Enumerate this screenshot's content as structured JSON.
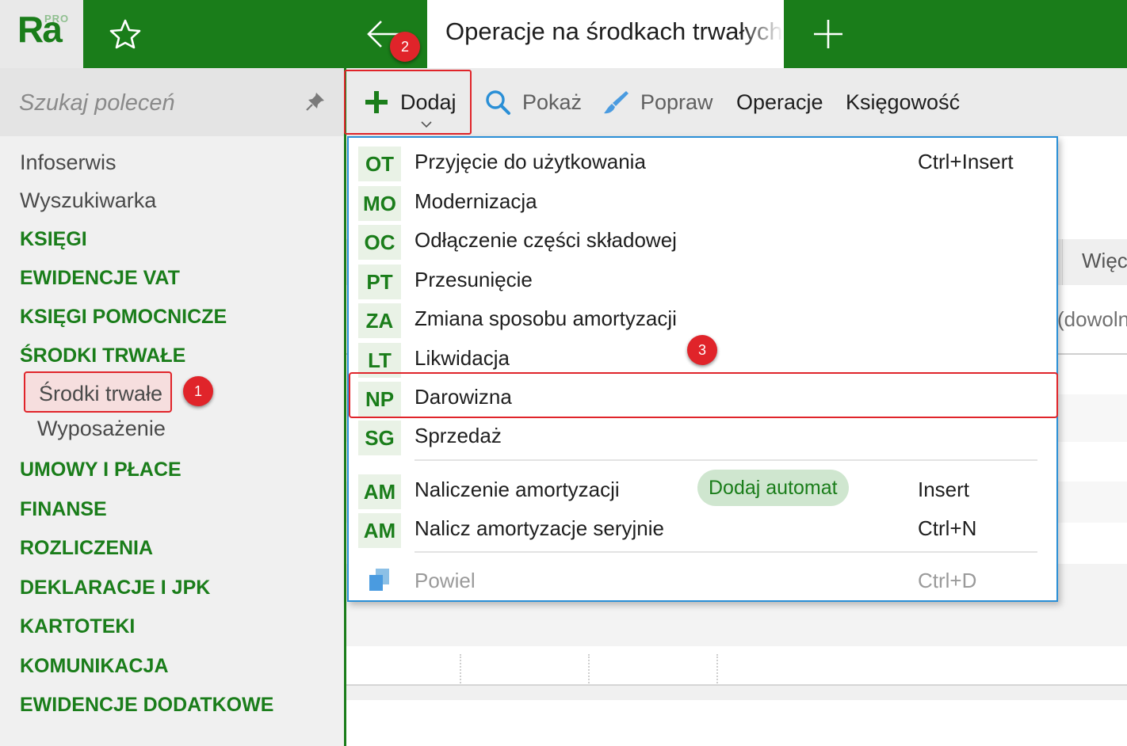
{
  "app": {
    "logo_text": "Ra",
    "logo_badge": "PRO",
    "tab_title": "Operacje na środkach trwałych",
    "icons": {
      "favorite": "star-icon",
      "back": "arrow-left-icon",
      "new_tab": "plus-icon"
    }
  },
  "colors": {
    "brand_green": "#1a7d1a",
    "highlight_red": "#e0242a",
    "menu_border_blue": "#2a8fd6"
  },
  "sidebar": {
    "search_placeholder": "Szukaj poleceń",
    "items": [
      {
        "label": "Infoserwis",
        "type": "plain"
      },
      {
        "label": "Wyszukiwarka",
        "type": "plain"
      },
      {
        "label": "KSIĘGI",
        "type": "group"
      },
      {
        "label": "EWIDENCJE VAT",
        "type": "group"
      },
      {
        "label": "KSIĘGI POMOCNICZE",
        "type": "group"
      },
      {
        "label": "ŚRODKI TRWAŁE",
        "type": "group"
      },
      {
        "label": "Środki trwałe",
        "type": "sub",
        "selected": true
      },
      {
        "label": "Wyposażenie",
        "type": "sub"
      },
      {
        "label": "UMOWY I PŁACE",
        "type": "group"
      },
      {
        "label": "FINANSE",
        "type": "group"
      },
      {
        "label": "ROZLICZENIA",
        "type": "group"
      },
      {
        "label": "DEKLARACJE I JPK",
        "type": "group"
      },
      {
        "label": "KARTOTEKI",
        "type": "group"
      },
      {
        "label": "KOMUNIKACJA",
        "type": "group"
      },
      {
        "label": "EWIDENCJE DODATKOWE",
        "type": "group"
      }
    ]
  },
  "toolbar": {
    "add": "Dodaj",
    "show": "Pokaż",
    "edit": "Popraw",
    "operations": "Operacje",
    "accounting": "Księgowość"
  },
  "background": {
    "column_header": "Więcej",
    "filter_hint": "(dowolne)"
  },
  "menu": {
    "items": [
      {
        "code": "OT",
        "label": "Przyjęcie do użytkowania",
        "shortcut": "Ctrl+Insert"
      },
      {
        "code": "MO",
        "label": "Modernizacja",
        "shortcut": ""
      },
      {
        "code": "OC",
        "label": "Odłączenie części składowej",
        "shortcut": ""
      },
      {
        "code": "PT",
        "label": "Przesunięcie",
        "shortcut": ""
      },
      {
        "code": "ZA",
        "label": "Zmiana sposobu amortyzacji",
        "shortcut": ""
      },
      {
        "code": "LT",
        "label": "Likwidacja",
        "shortcut": ""
      },
      {
        "code": "NP",
        "label": "Darowizna",
        "shortcut": "",
        "highlighted": true
      },
      {
        "code": "SG",
        "label": "Sprzedaż",
        "shortcut": ""
      }
    ],
    "amort_items": [
      {
        "code": "AM",
        "label": "Naliczenie amortyzacji",
        "shortcut": "Insert",
        "pill": "Dodaj automat"
      },
      {
        "code": "AM",
        "label": "Nalicz amortyzacje seryjnie",
        "shortcut": "Ctrl+N"
      }
    ],
    "duplicate": {
      "label": "Powiel",
      "shortcut": "Ctrl+D",
      "enabled": false,
      "icon": "copy-icon"
    }
  },
  "annotations": {
    "step1": "1",
    "step2": "2",
    "step3": "3"
  }
}
